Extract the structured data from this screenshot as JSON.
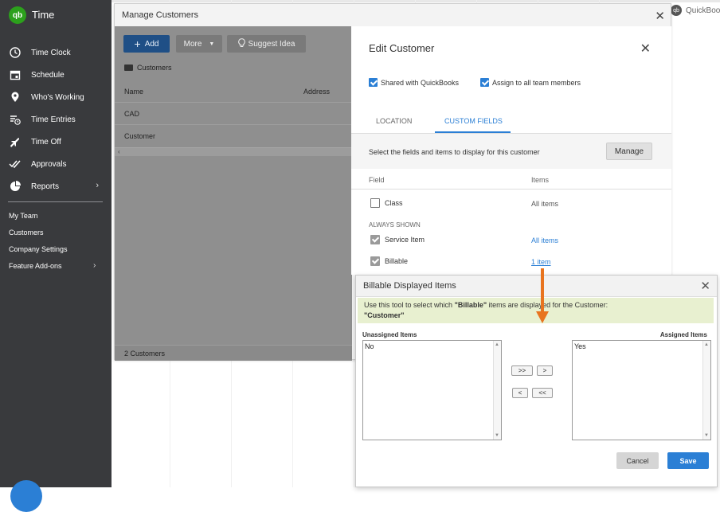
{
  "app": {
    "title": "Time",
    "logo_text": "qb"
  },
  "sidebar": {
    "items": [
      {
        "label": "Time Clock",
        "icon": "clock-icon"
      },
      {
        "label": "Schedule",
        "icon": "calendar-icon"
      },
      {
        "label": "Who's Working",
        "icon": "map-pin-icon"
      },
      {
        "label": "Time Entries",
        "icon": "list-clock-icon"
      },
      {
        "label": "Time Off",
        "icon": "airplane-icon"
      },
      {
        "label": "Approvals",
        "icon": "double-check-icon"
      },
      {
        "label": "Reports",
        "icon": "pie-chart-icon"
      }
    ],
    "sub_items": [
      {
        "label": "My Team"
      },
      {
        "label": "Customers"
      },
      {
        "label": "Company Settings"
      },
      {
        "label": "Feature Add-ons"
      }
    ]
  },
  "top_brand": {
    "label": "QuickBoo"
  },
  "manage_customers": {
    "title": "Manage Customers",
    "add_label": "Add",
    "more_label": "More",
    "suggest_label": "Suggest Idea",
    "breadcrumb": "Customers",
    "columns": {
      "name": "Name",
      "address": "Address"
    },
    "rows": [
      {
        "name": "CAD"
      },
      {
        "name": "Customer"
      }
    ],
    "footer": "2 Customers"
  },
  "edit_customer": {
    "title": "Edit Customer",
    "shared_label": "Shared with QuickBooks",
    "assign_label": "Assign to all team members",
    "tabs": {
      "location": "LOCATION",
      "custom_fields": "CUSTOM FIELDS"
    },
    "select_text": "Select the fields and items to display for this customer",
    "manage_label": "Manage",
    "columns": {
      "field": "Field",
      "items": "Items"
    },
    "class_field": {
      "label": "Class",
      "items": "All items"
    },
    "always_shown": "ALWAYS SHOWN",
    "service_item": {
      "label": "Service Item",
      "items": "All items"
    },
    "billable": {
      "label": "Billable",
      "items": "1 item"
    }
  },
  "billable_dialog": {
    "title": "Billable Displayed Items",
    "info_prefix": "Use this tool to select which ",
    "info_bold": "\"Billable\"",
    "info_suffix": " items are displayed for the Customer:",
    "info_customer": "\"Customer\"",
    "unassigned_label": "Unassigned Items",
    "assigned_label": "Assigned Items",
    "unassigned_items": [
      "No"
    ],
    "assigned_items": [
      "Yes"
    ],
    "move_all_right": ">>",
    "move_right": ">",
    "move_left": "<",
    "move_all_left": "<<",
    "cancel_label": "Cancel",
    "save_label": "Save"
  },
  "colors": {
    "sidebar_bg": "#393a3d",
    "brand_green": "#2ca01c",
    "accent_blue": "#2b7fd5",
    "annotation_orange": "#e8741f",
    "info_band": "#e8f0d0"
  }
}
